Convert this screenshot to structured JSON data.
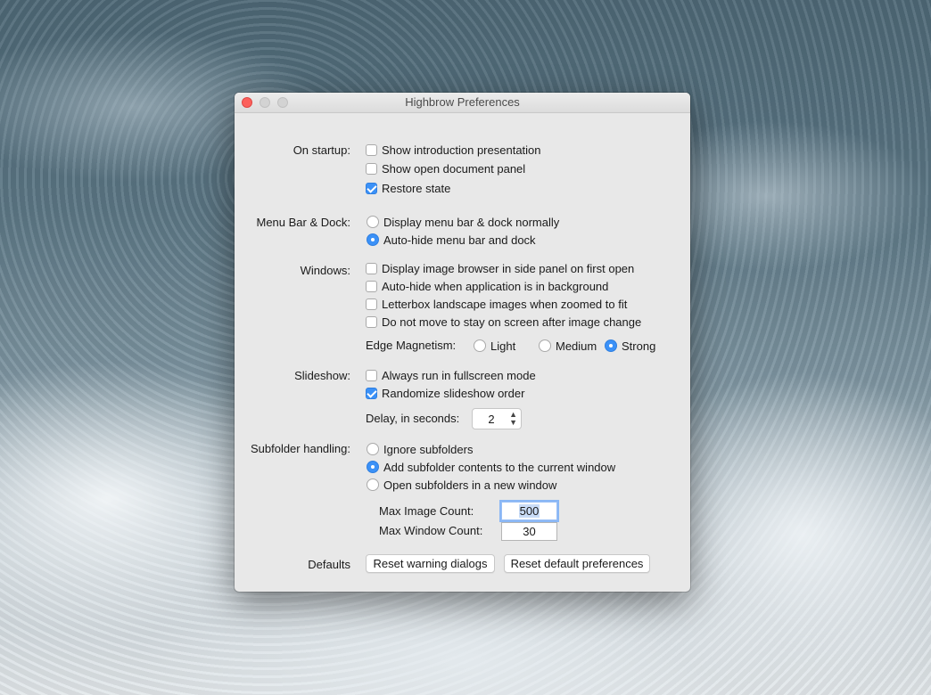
{
  "window": {
    "title": "Highbrow Preferences"
  },
  "startup": {
    "label": "On startup:",
    "options": [
      {
        "label": "Show introduction presentation",
        "checked": false
      },
      {
        "label": "Show open document panel",
        "checked": false
      },
      {
        "label": "Restore state",
        "checked": true
      }
    ]
  },
  "menubar": {
    "label": "Menu Bar & Dock:",
    "options": [
      {
        "label": "Display menu bar & dock normally",
        "selected": false
      },
      {
        "label": "Auto-hide menu bar and dock",
        "selected": true
      }
    ]
  },
  "windows": {
    "label": "Windows:",
    "options": [
      {
        "label": "Display image browser in side panel on first open",
        "checked": false
      },
      {
        "label": "Auto-hide when application is in background",
        "checked": false
      },
      {
        "label": "Letterbox landscape images when zoomed to fit",
        "checked": false
      },
      {
        "label": "Do not move to stay on screen after image change",
        "checked": false
      }
    ],
    "edge_magnetism": {
      "label": "Edge Magnetism:",
      "options": [
        {
          "label": "Light",
          "selected": false
        },
        {
          "label": "Medium",
          "selected": false
        },
        {
          "label": "Strong",
          "selected": true
        }
      ]
    }
  },
  "slideshow": {
    "label": "Slideshow:",
    "options": [
      {
        "label": "Always run in fullscreen mode",
        "checked": false
      },
      {
        "label": "Randomize slideshow order",
        "checked": true
      }
    ],
    "delay_label": "Delay, in seconds:",
    "delay_value": "2"
  },
  "subfolder": {
    "label": "Subfolder handling:",
    "options": [
      {
        "label": "Ignore subfolders",
        "selected": false
      },
      {
        "label": "Add subfolder contents to the current window",
        "selected": true
      },
      {
        "label": "Open subfolders in a new window",
        "selected": false
      }
    ],
    "max_image_label": "Max Image Count:",
    "max_image_value": "500",
    "max_window_label": "Max Window Count:",
    "max_window_value": "30"
  },
  "defaults": {
    "label": "Defaults",
    "reset_warning": "Reset warning dialogs",
    "reset_prefs": "Reset default preferences"
  },
  "colors": {
    "accent": "#3b91f7",
    "close": "#fc605c"
  },
  "icons": {
    "checkmark": "checkmark-icon",
    "stepper": "stepper-arrows-icon"
  }
}
